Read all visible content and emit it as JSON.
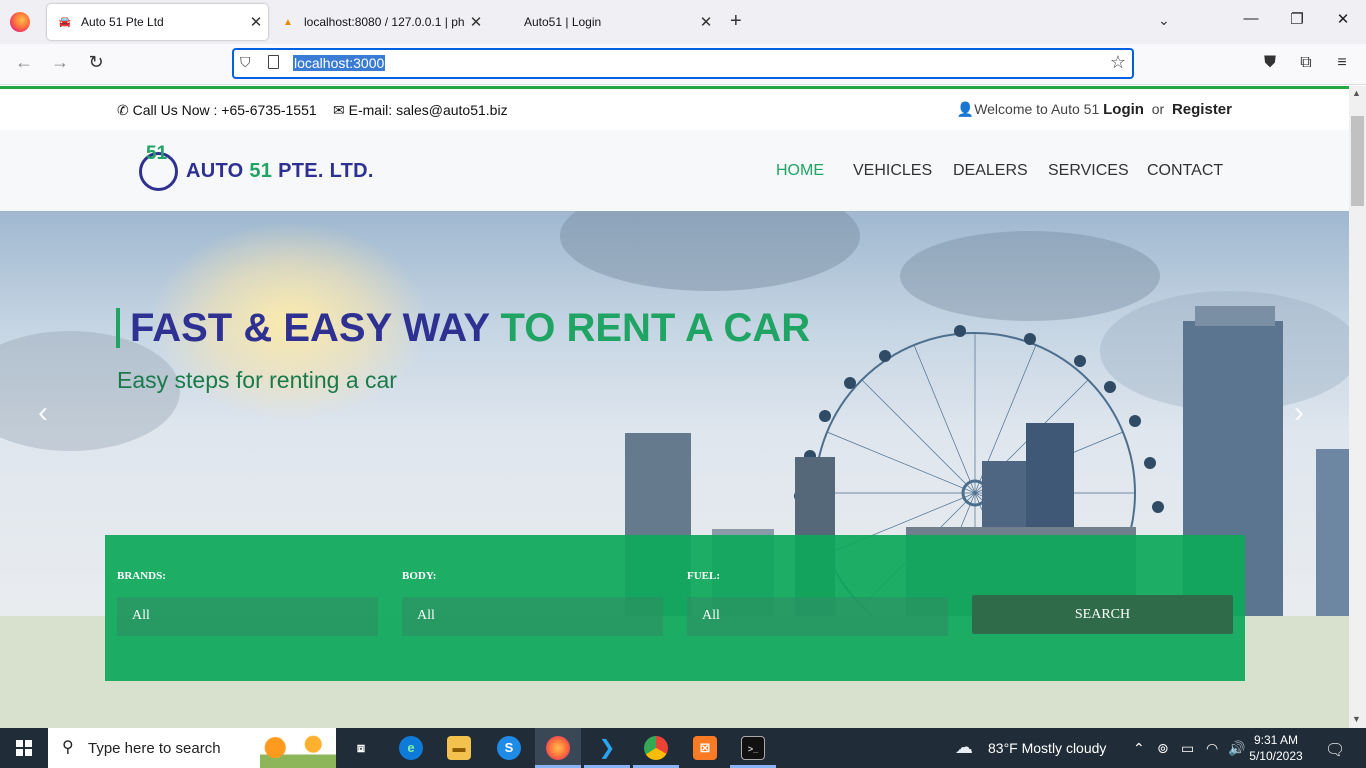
{
  "browser": {
    "tabs": [
      {
        "title": "Auto 51 Pte Ltd",
        "active": true
      },
      {
        "title": "localhost:8080 / 127.0.0.1 | php",
        "active": false
      },
      {
        "title": "Auto51 | Login",
        "active": false
      }
    ],
    "url": "localhost:3000"
  },
  "site": {
    "topbar": {
      "call": "Call Us Now : +65-6735-1551",
      "email": "E-mail: sales@auto51.biz",
      "welcome": "Welcome to Auto 51",
      "login": "Login",
      "or": "or",
      "register": "Register"
    },
    "logo": {
      "badge": "51",
      "name_part1": "AUTO",
      "name_part2": "51",
      "name_part3": "PTE. LTD."
    },
    "menu": [
      "HOME",
      "VEHICLES",
      "DEALERS",
      "SERVICES",
      "CONTACT"
    ],
    "hero": {
      "title_part1": "FAST & EASY WAY",
      "title_part2": "TO RENT A CAR",
      "subtitle": "Easy steps for renting a car",
      "prev_arrow": "‹",
      "next_arrow": "›"
    },
    "search": {
      "brands_label": "BRANDS:",
      "body_label": "BODY:",
      "fuel_label": "FUEL:",
      "brands_value": "All",
      "body_value": "All",
      "fuel_value": "All",
      "button": "SEARCH"
    }
  },
  "taskbar": {
    "search_placeholder": "Type here to search",
    "weather": "83°F  Mostly cloudy",
    "time": "9:31 AM",
    "date": "5/10/2023"
  },
  "colors": {
    "brand_blue": "#2e3191",
    "brand_green": "#1fa463",
    "search_bg": "#0ea85a"
  }
}
